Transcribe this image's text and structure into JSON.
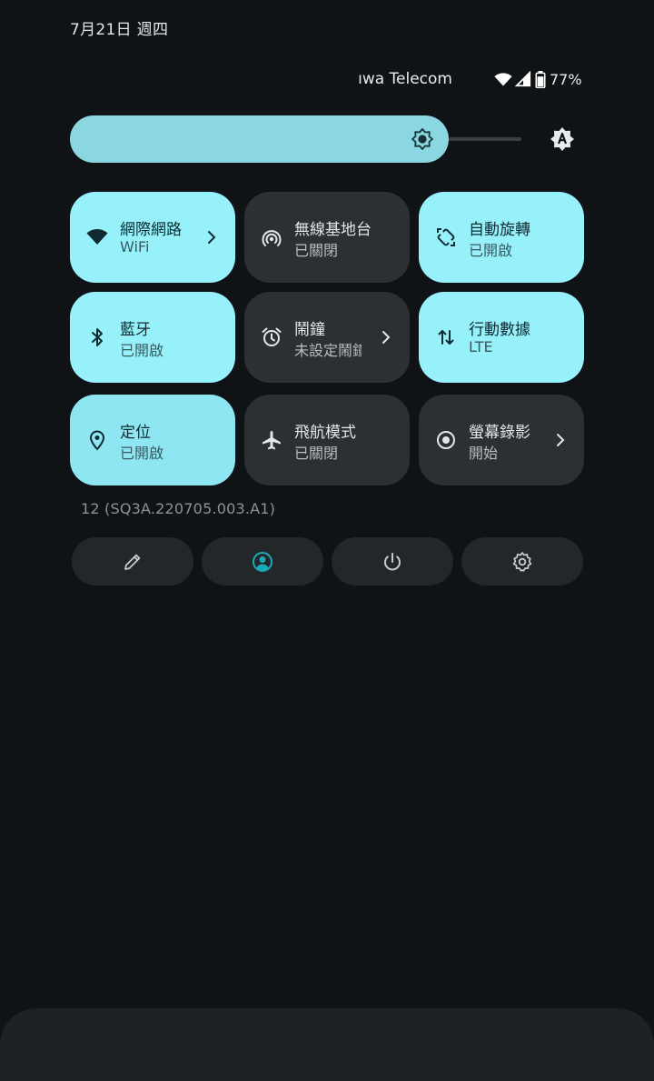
{
  "status": {
    "date": "7月21日 週四",
    "carrier": "ıwa Telecom",
    "battery_percent": "77%",
    "icons": [
      "wifi-icon",
      "cell-signal-icon",
      "battery-icon"
    ]
  },
  "brightness": {
    "level": 0.82,
    "icons": [
      "brightness-icon",
      "auto-brightness-icon"
    ]
  },
  "tiles": [
    {
      "label": "網際網路",
      "sub": "WiFi",
      "state": "on",
      "icon": "wifi-icon",
      "chevron": true
    },
    {
      "label": "無線基地台",
      "sub": "已關閉",
      "state": "off",
      "icon": "hotspot-icon",
      "chevron": false
    },
    {
      "label": "自動旋轉",
      "sub": "已開啟",
      "state": "on",
      "icon": "auto-rotate-icon",
      "chevron": false
    },
    {
      "label": "藍牙",
      "sub": "已開啟",
      "state": "on",
      "icon": "bluetooth-icon",
      "chevron": false
    },
    {
      "label": "鬧鐘",
      "sub": "未設定鬧鐘",
      "state": "off",
      "icon": "alarm-icon",
      "chevron": true
    },
    {
      "label": "行動數據",
      "sub": "LTE",
      "state": "on",
      "icon": "mobile-data-icon",
      "chevron": false
    },
    {
      "label": "定位",
      "sub": "已開啟",
      "state": "on",
      "icon": "location-icon",
      "chevron": false
    },
    {
      "label": "飛航模式",
      "sub": "已關閉",
      "state": "off",
      "icon": "airplane-icon",
      "chevron": false
    },
    {
      "label": "螢幕錄影",
      "sub": "開始",
      "state": "off",
      "icon": "screen-record-icon",
      "chevron": true
    }
  ],
  "build_number": "12 (SQ3A.220705.003.A1)",
  "footer": [
    "edit-icon",
    "user-icon",
    "power-icon",
    "settings-icon"
  ],
  "colors": {
    "background": "#0f1316",
    "tile_on": "#97f1fb",
    "tile_off": "#2c3033",
    "accent": "#1aa9b8"
  }
}
